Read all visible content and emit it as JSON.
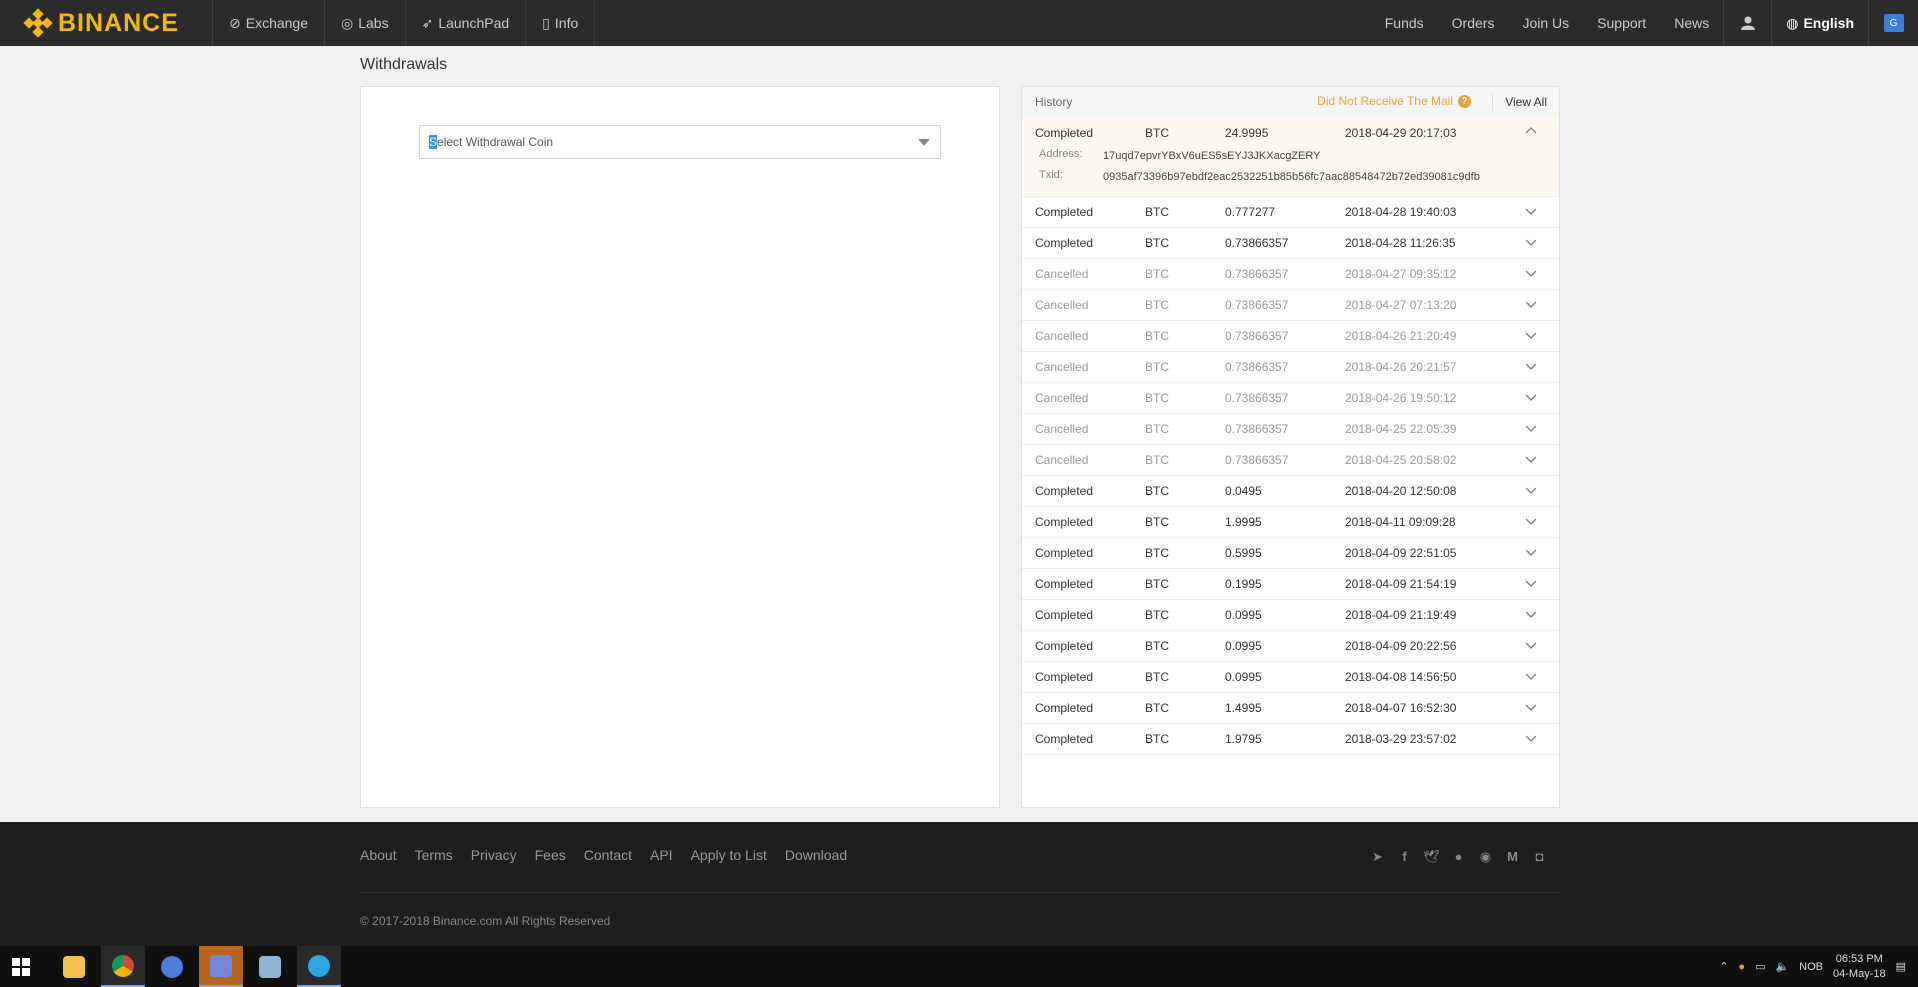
{
  "nav": {
    "brand": "BINANCE",
    "items": [
      {
        "label": "Exchange",
        "icon": "exchange-icon"
      },
      {
        "label": "Labs",
        "icon": "labs-icon"
      },
      {
        "label": "LaunchPad",
        "icon": "launchpad-icon"
      },
      {
        "label": "Info",
        "icon": "info-icon"
      }
    ],
    "right": [
      "Funds",
      "Orders",
      "Join Us",
      "Support",
      "News"
    ],
    "language": "English"
  },
  "page": {
    "title": "Withdrawals",
    "coin_select_cursor": "S",
    "coin_select_rest": "elect Withdrawal Coin"
  },
  "history": {
    "title": "History",
    "mail_link": "Did Not Receive The Mail",
    "view_all": "View All",
    "expanded": {
      "status": "Completed",
      "coin": "BTC",
      "amount": "24.9995",
      "date": "2018-04-29 20:17:03",
      "address_label": "Address:",
      "address": "17uqd7epvrYBxV6uES5sEYJ3JKXacgZERY",
      "txid_label": "Txid:",
      "txid": "0935af73396b97ebdf2eac2532251b85b56fc7aac88548472b72ed39081c9dfb"
    },
    "rows": [
      {
        "status": "Completed",
        "coin": "BTC",
        "amount": "0.777277",
        "date": "2018-04-28 19:40:03"
      },
      {
        "status": "Completed",
        "coin": "BTC",
        "amount": "0.73866357",
        "date": "2018-04-28 11:26:35"
      },
      {
        "status": "Cancelled",
        "coin": "BTC",
        "amount": "0.73866357",
        "date": "2018-04-27 09:35:12"
      },
      {
        "status": "Cancelled",
        "coin": "BTC",
        "amount": "0.73866357",
        "date": "2018-04-27 07:13:20"
      },
      {
        "status": "Cancelled",
        "coin": "BTC",
        "amount": "0.73866357",
        "date": "2018-04-26 21:20:49"
      },
      {
        "status": "Cancelled",
        "coin": "BTC",
        "amount": "0.73866357",
        "date": "2018-04-26 20:21:57"
      },
      {
        "status": "Cancelled",
        "coin": "BTC",
        "amount": "0.73866357",
        "date": "2018-04-26 19:50:12"
      },
      {
        "status": "Cancelled",
        "coin": "BTC",
        "amount": "0.73866357",
        "date": "2018-04-25 22:05:39"
      },
      {
        "status": "Cancelled",
        "coin": "BTC",
        "amount": "0.73866357",
        "date": "2018-04-25 20:58:02"
      },
      {
        "status": "Completed",
        "coin": "BTC",
        "amount": "0.0495",
        "date": "2018-04-20 12:50:08"
      },
      {
        "status": "Completed",
        "coin": "BTC",
        "amount": "1.9995",
        "date": "2018-04-11 09:09:28"
      },
      {
        "status": "Completed",
        "coin": "BTC",
        "amount": "0.5995",
        "date": "2018-04-09 22:51:05"
      },
      {
        "status": "Completed",
        "coin": "BTC",
        "amount": "0.1995",
        "date": "2018-04-09 21:54:19"
      },
      {
        "status": "Completed",
        "coin": "BTC",
        "amount": "0.0995",
        "date": "2018-04-09 21:19:49"
      },
      {
        "status": "Completed",
        "coin": "BTC",
        "amount": "0.0995",
        "date": "2018-04-09 20:22:56"
      },
      {
        "status": "Completed",
        "coin": "BTC",
        "amount": "0.0995",
        "date": "2018-04-08 14:56:50"
      },
      {
        "status": "Completed",
        "coin": "BTC",
        "amount": "1.4995",
        "date": "2018-04-07 16:52:30"
      },
      {
        "status": "Completed",
        "coin": "BTC",
        "amount": "1.9795",
        "date": "2018-03-29 23:57:02"
      }
    ]
  },
  "footer": {
    "links": [
      "About",
      "Terms",
      "Privacy",
      "Fees",
      "Contact",
      "API",
      "Apply to List",
      "Download"
    ],
    "social": [
      "telegram-icon",
      "facebook-icon",
      "twitter-icon",
      "reddit-icon",
      "github-icon",
      "medium-icon",
      "instagram-icon"
    ],
    "copyright": "© 2017-2018 Binance.com All Rights Reserved"
  },
  "taskbar": {
    "apps": [
      "file-explorer-icon",
      "chrome-icon",
      "google-icon",
      "discord-icon",
      "notepad-icon",
      "telegram-icon"
    ],
    "ime": "NOB",
    "time": "06:53 PM",
    "date": "04-May-18"
  },
  "colors": {
    "brand": "#f0b90b",
    "nav_bg": "#2b2b2b",
    "link_orange": "#e8a33c",
    "footer_bg": "#1e1e1e"
  }
}
